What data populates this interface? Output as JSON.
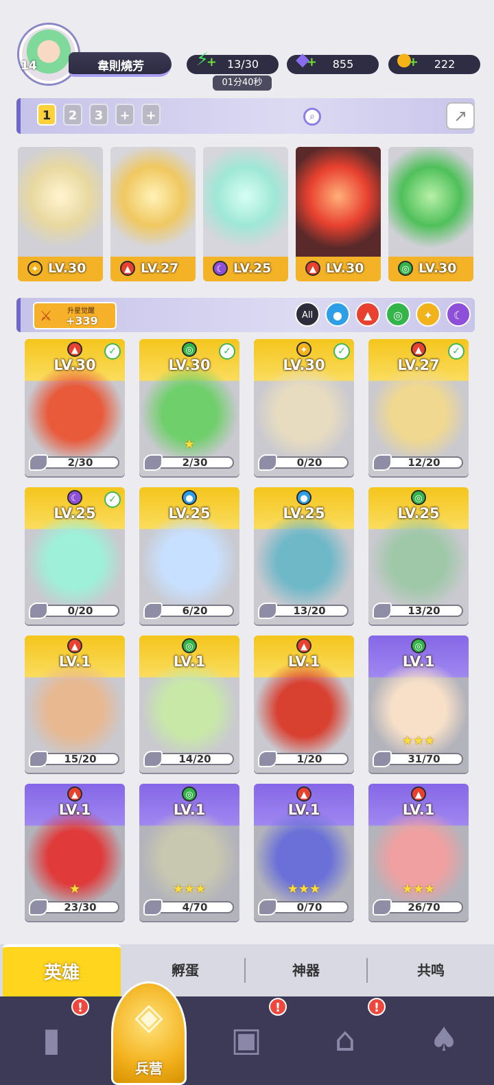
{
  "player": {
    "level": "14",
    "name": "韋則燒芳"
  },
  "resources": {
    "energy": {
      "icon": "lightning-icon",
      "value": "13/30",
      "timer": "01分40秒"
    },
    "gems": {
      "icon": "diamond-icon",
      "value": "855"
    },
    "coins": {
      "icon": "coin-icon",
      "value": "222"
    }
  },
  "team_tabs": [
    "1",
    "2",
    "3",
    "+",
    "+"
  ],
  "team": [
    {
      "element": "light",
      "level": "LV.30"
    },
    {
      "element": "fire",
      "level": "LV.27"
    },
    {
      "element": "dark",
      "level": "LV.25"
    },
    {
      "element": "fire",
      "level": "LV.30"
    },
    {
      "element": "nature",
      "level": "LV.30"
    }
  ],
  "star_awaken": {
    "label": "升星觉醒",
    "value": "+339"
  },
  "filters": [
    "All",
    "water",
    "fire",
    "nature",
    "light",
    "dark"
  ],
  "heroes": [
    {
      "element": "fire",
      "level": "LV.30",
      "shards": "2/30",
      "rarity": "gold",
      "checked": true,
      "stars": ""
    },
    {
      "element": "nature",
      "level": "LV.30",
      "shards": "2/30",
      "rarity": "gold",
      "checked": true,
      "stars": "★"
    },
    {
      "element": "light",
      "level": "LV.30",
      "shards": "0/20",
      "rarity": "gold",
      "checked": true,
      "stars": ""
    },
    {
      "element": "fire",
      "level": "LV.27",
      "shards": "12/20",
      "rarity": "gold",
      "checked": true,
      "stars": ""
    },
    {
      "element": "dark",
      "level": "LV.25",
      "shards": "0/20",
      "rarity": "gold",
      "checked": true,
      "stars": ""
    },
    {
      "element": "water",
      "level": "LV.25",
      "shards": "6/20",
      "rarity": "gold",
      "checked": false,
      "stars": ""
    },
    {
      "element": "water",
      "level": "LV.25",
      "shards": "13/20",
      "rarity": "gold",
      "checked": false,
      "stars": ""
    },
    {
      "element": "nature",
      "level": "LV.25",
      "shards": "13/20",
      "rarity": "gold",
      "checked": false,
      "stars": ""
    },
    {
      "element": "fire",
      "level": "LV.1",
      "shards": "15/20",
      "rarity": "gold",
      "checked": false,
      "stars": ""
    },
    {
      "element": "nature",
      "level": "LV.1",
      "shards": "14/20",
      "rarity": "gold",
      "checked": false,
      "stars": ""
    },
    {
      "element": "fire",
      "level": "LV.1",
      "shards": "1/20",
      "rarity": "gold",
      "checked": false,
      "stars": ""
    },
    {
      "element": "nature",
      "level": "LV.1",
      "shards": "31/70",
      "rarity": "purple",
      "checked": false,
      "stars": "★★★"
    },
    {
      "element": "fire",
      "level": "LV.1",
      "shards": "23/30",
      "rarity": "purple",
      "checked": false,
      "stars": "★"
    },
    {
      "element": "nature",
      "level": "LV.1",
      "shards": "4/70",
      "rarity": "purple",
      "checked": false,
      "stars": "★★★"
    },
    {
      "element": "fire",
      "level": "LV.1",
      "shards": "0/70",
      "rarity": "purple",
      "checked": false,
      "stars": "★★★"
    },
    {
      "element": "fire",
      "level": "LV.1",
      "shards": "26/70",
      "rarity": "purple",
      "checked": false,
      "stars": "★★★"
    }
  ],
  "sub_tabs": [
    "英雄",
    "孵蛋",
    "神器",
    "共鸣"
  ],
  "nav": {
    "barracks_label": "兵营"
  },
  "colors": {
    "fire": "#e8412f",
    "water": "#2e9fe6",
    "nature": "#34b54a",
    "light": "#f2b21c",
    "dark": "#8e4fd9",
    "gold": "#f4c51c",
    "purple": "#8567e7"
  }
}
